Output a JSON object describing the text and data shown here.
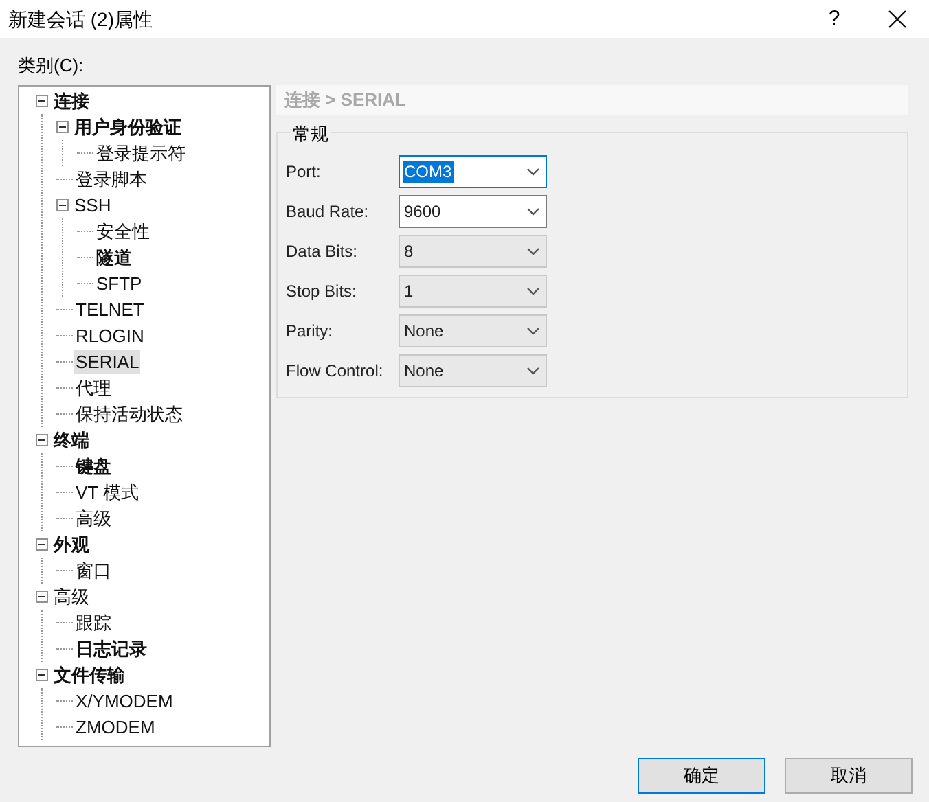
{
  "window": {
    "title": "新建会话 (2)属性",
    "help": "?"
  },
  "category_label": "类别(C):",
  "tree": [
    {
      "label": "连接",
      "bold": true,
      "expanded": true,
      "selected": false,
      "children": [
        {
          "label": "用户身份验证",
          "bold": true,
          "expanded": true,
          "selected": false,
          "children": [
            {
              "label": "登录提示符",
              "bold": false,
              "selected": false
            }
          ]
        },
        {
          "label": "登录脚本",
          "bold": false,
          "selected": false
        },
        {
          "label": "SSH",
          "bold": false,
          "expanded": true,
          "selected": false,
          "children": [
            {
              "label": "安全性",
              "bold": false,
              "selected": false
            },
            {
              "label": "隧道",
              "bold": true,
              "selected": false
            },
            {
              "label": "SFTP",
              "bold": false,
              "selected": false
            }
          ]
        },
        {
          "label": "TELNET",
          "bold": false,
          "selected": false
        },
        {
          "label": "RLOGIN",
          "bold": false,
          "selected": false
        },
        {
          "label": "SERIAL",
          "bold": false,
          "selected": true
        },
        {
          "label": "代理",
          "bold": false,
          "selected": false
        },
        {
          "label": "保持活动状态",
          "bold": false,
          "selected": false
        }
      ]
    },
    {
      "label": "终端",
      "bold": true,
      "expanded": true,
      "selected": false,
      "children": [
        {
          "label": "键盘",
          "bold": true,
          "selected": false
        },
        {
          "label": "VT 模式",
          "bold": false,
          "selected": false
        },
        {
          "label": "高级",
          "bold": false,
          "selected": false
        }
      ]
    },
    {
      "label": "外观",
      "bold": true,
      "expanded": true,
      "selected": false,
      "children": [
        {
          "label": "窗口",
          "bold": false,
          "selected": false
        }
      ]
    },
    {
      "label": "高级",
      "bold": false,
      "expanded": true,
      "selected": false,
      "children": [
        {
          "label": "跟踪",
          "bold": false,
          "selected": false
        },
        {
          "label": "日志记录",
          "bold": true,
          "selected": false
        }
      ]
    },
    {
      "label": "文件传输",
      "bold": true,
      "expanded": true,
      "selected": false,
      "children": [
        {
          "label": "X/YMODEM",
          "bold": false,
          "selected": false
        },
        {
          "label": "ZMODEM",
          "bold": false,
          "selected": false
        }
      ]
    }
  ],
  "breadcrumb": "连接 > SERIAL",
  "group": {
    "title": "常规",
    "fields": [
      {
        "label": "Port:",
        "value": "COM3",
        "focused": true,
        "disabled": false
      },
      {
        "label": "Baud Rate:",
        "value": "9600",
        "focused": false,
        "disabled": false
      },
      {
        "label": "Data Bits:",
        "value": "8",
        "focused": false,
        "disabled": true
      },
      {
        "label": "Stop Bits:",
        "value": "1",
        "focused": false,
        "disabled": true
      },
      {
        "label": "Parity:",
        "value": "None",
        "focused": false,
        "disabled": true
      },
      {
        "label": "Flow Control:",
        "value": "None",
        "focused": false,
        "disabled": true
      }
    ]
  },
  "buttons": [
    {
      "label": "确定",
      "default": true
    },
    {
      "label": "取消",
      "default": false
    }
  ]
}
